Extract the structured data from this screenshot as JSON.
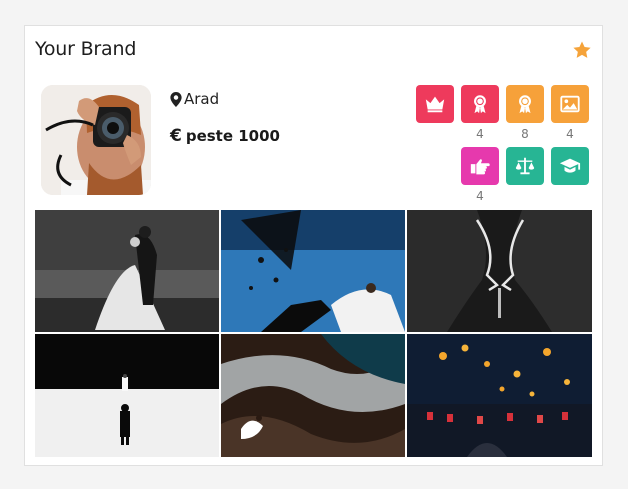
{
  "card": {
    "title": "Your Brand",
    "favorite_icon": "star-icon",
    "accent_color": "#f5a33a"
  },
  "vendor": {
    "location": "Arad",
    "location_icon": "map-marker-icon",
    "price_symbol": "€",
    "price": "peste 1000"
  },
  "badges": [
    {
      "icon": "crown-icon",
      "color": "#ee3a5c",
      "count": ""
    },
    {
      "icon": "award-ribbon-icon",
      "color": "#ee3a5c",
      "count": "4"
    },
    {
      "icon": "award-ribbon-icon",
      "color": "#f6a13a",
      "count": "8"
    },
    {
      "icon": "image-icon",
      "color": "#f6a13a",
      "count": "4"
    },
    {
      "icon": "hand-pointing-icon",
      "color": "#e639ad",
      "count": "4"
    },
    {
      "icon": "scales-icon",
      "color": "#27b594",
      "count": ""
    },
    {
      "icon": "graduation-cap-icon",
      "color": "#27b594",
      "count": ""
    }
  ],
  "gallery": [
    {
      "description": "couple-dancing-in-rain"
    },
    {
      "description": "bride-groom-flying-objects-blue-sky"
    },
    {
      "description": "couple-silhouette-kiss"
    },
    {
      "description": "bride-groom-standing-apart-white-floor"
    },
    {
      "description": "couple-on-rocks-waves"
    },
    {
      "description": "lanterns-night-party"
    }
  ]
}
